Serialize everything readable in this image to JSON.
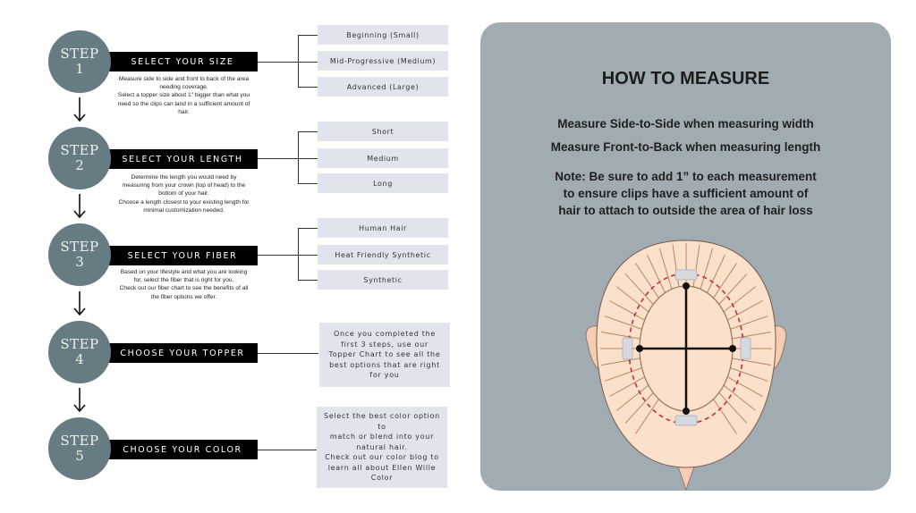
{
  "steps": [
    {
      "word": "STEP",
      "number": "1",
      "title": "SELECT YOUR SIZE",
      "description": [
        "Measure side to side and front to back of the area",
        "needing coverage.",
        "Select a topper size about 1\" bigger than what you",
        "need so the clips can land in a sufficient amount of",
        "hair."
      ],
      "options": [
        "Beginning  (Small)",
        "Mid-Progressive  (Medium)",
        "Advanced  (Large)"
      ]
    },
    {
      "word": "STEP",
      "number": "2",
      "title": "SELECT YOUR LENGTH",
      "description": [
        "Determine the length you would need by",
        "measuring from your crown (top of head) to the",
        "bottom of your hair.",
        "Choose a length closest to your existing length for",
        "minimal customization needed."
      ],
      "options": [
        "Short",
        "Medium",
        "Long"
      ]
    },
    {
      "word": "STEP",
      "number": "3",
      "title": "SELECT YOUR FIBER",
      "description": [
        "Based on your lifestyle and what you are looking",
        "for, select the fiber that is right for you.",
        "Check out our fiber chart to see the benefits of all",
        "the fiber options we offer."
      ],
      "options": [
        "Human Hair",
        "Heat Friendly Synthetic",
        "Synthetic"
      ]
    },
    {
      "word": "STEP",
      "number": "4",
      "title": "CHOOSE YOUR TOPPER",
      "info": [
        "Once you completed the",
        "first 3 steps, use our",
        "Topper Chart to see all the",
        "best options that are right",
        "for you"
      ]
    },
    {
      "word": "STEP",
      "number": "5",
      "title": "CHOOSE YOUR COLOR",
      "info": [
        "Select the best color option to",
        "match or blend into your",
        "natural hair.",
        "Check out our color blog to",
        "learn all about Ellen Wille",
        "Color"
      ]
    }
  ],
  "measure": {
    "title": "HOW TO MEASURE",
    "width_rule": "Measure Side-to-Side when measuring width",
    "length_rule": "Measure Front-to-Back when measuring length",
    "note": [
      "Note: Be sure to add 1” to each measurement",
      "to ensure clips have a sufficient amount of",
      "hair to attach to  outside the area of hair loss"
    ]
  },
  "colors": {
    "step_circle": "#667b82",
    "step_bar": "#000000",
    "option_box": "#e1e4ec",
    "panel": "#a1acb2",
    "skin": "#fbe0cc",
    "hair_lines": "#b5895f",
    "clip_path": "#cc2b3a"
  }
}
